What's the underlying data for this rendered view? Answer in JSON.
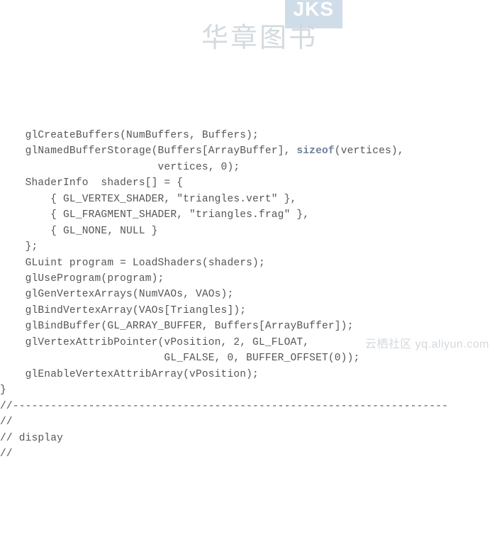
{
  "watermark_books": "JKS",
  "watermark_cn": "华章图书",
  "watermark_footer": "云栖社区 yq.aliyun.com",
  "lines": [
    "    glCreateBuffers(NumBuffers, Buffers);",
    "    glNamedBufferStorage(Buffers[ArrayBuffer], ",
    "(vertices),",
    "                         vertices, 0);",
    "",
    "    ShaderInfo  shaders[] = {",
    "        { GL_VERTEX_SHADER, \"triangles.vert\" },",
    "        { GL_FRAGMENT_SHADER, \"triangles.frag\" },",
    "        { GL_NONE, NULL }",
    "    };",
    "",
    "    GLuint program = LoadShaders(shaders);",
    "    glUseProgram(program);",
    "",
    "    glGenVertexArrays(NumVAOs, VAOs);",
    "    glBindVertexArray(VAOs[Triangles]);",
    "    glBindBuffer(GL_ARRAY_BUFFER, Buffers[ArrayBuffer]);",
    "    glVertexAttribPointer(vPosition, 2, GL_FLOAT,",
    "                          GL_FALSE, 0, BUFFER_OFFSET(0));",
    "    glEnableVertexAttribArray(vPosition);",
    "}",
    "",
    "//---------------------------------------------------------------------",
    "//",
    "// display",
    "//"
  ],
  "keyword_sizeof": "sizeof"
}
